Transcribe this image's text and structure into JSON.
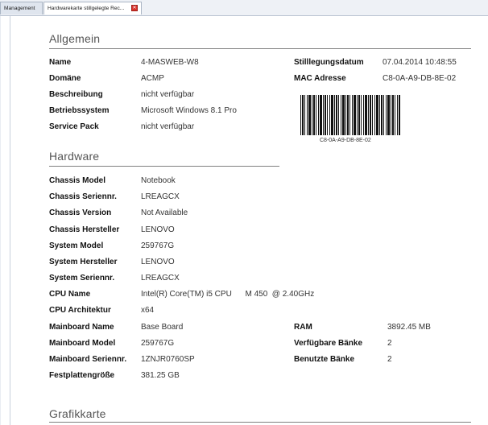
{
  "tabs": [
    {
      "label": "Management"
    },
    {
      "label": "Hardwarekarte stillgelegte Rec..."
    }
  ],
  "sections": {
    "allgemein": "Allgemein",
    "hardware": "Hardware",
    "grafikkarte": "Grafikkarte"
  },
  "allgemein": {
    "rows": [
      {
        "label": "Name",
        "value": "4-MASWEB-W8"
      },
      {
        "label": "Domäne",
        "value": "ACMP"
      },
      {
        "label": "Beschreibung",
        "value": "nicht verfügbar"
      },
      {
        "label": "Betriebssystem",
        "value": "Microsoft Windows 8.1 Pro"
      },
      {
        "label": "Service Pack",
        "value": "nicht verfügbar"
      }
    ],
    "right_rows": [
      {
        "label": "Stilllegungsdatum",
        "value": "07.04.2014 10:48:55"
      },
      {
        "label": "MAC Adresse",
        "value": "C8-0A-A9-DB-8E-02"
      }
    ],
    "barcode_text": "C8-0A-A9-DB-8E-02"
  },
  "hardware": {
    "rows": [
      {
        "label": "Chassis Model",
        "value": "Notebook"
      },
      {
        "label": "Chassis Seriennr.",
        "value": "LREAGCX"
      },
      {
        "label": "Chassis Version",
        "value": "Not Available"
      },
      {
        "label": "Chassis Hersteller",
        "value": "LENOVO"
      },
      {
        "label": "System Model",
        "value": "259767G"
      },
      {
        "label": "System Hersteller",
        "value": "LENOVO"
      },
      {
        "label": "System Seriennr.",
        "value": "LREAGCX"
      },
      {
        "label": "CPU Name",
        "value": "Intel(R) Core(TM) i5 CPU      M 450  @ 2.40GHz"
      },
      {
        "label": "CPU Architektur",
        "value": "x64"
      },
      {
        "label": "Mainboard Name",
        "value": "Base Board"
      },
      {
        "label": "Mainboard Model",
        "value": "259767G"
      },
      {
        "label": "Mainboard Seriennr.",
        "value": "1ZNJR0760SP"
      },
      {
        "label": "Festplattengröße",
        "value": "381.25 GB"
      }
    ],
    "right_rows": [
      {
        "label": "RAM",
        "value": "3892.45 MB"
      },
      {
        "label": "Verfügbare Bänke",
        "value": "2"
      },
      {
        "label": "Benutzte Bänke",
        "value": "2"
      }
    ]
  }
}
